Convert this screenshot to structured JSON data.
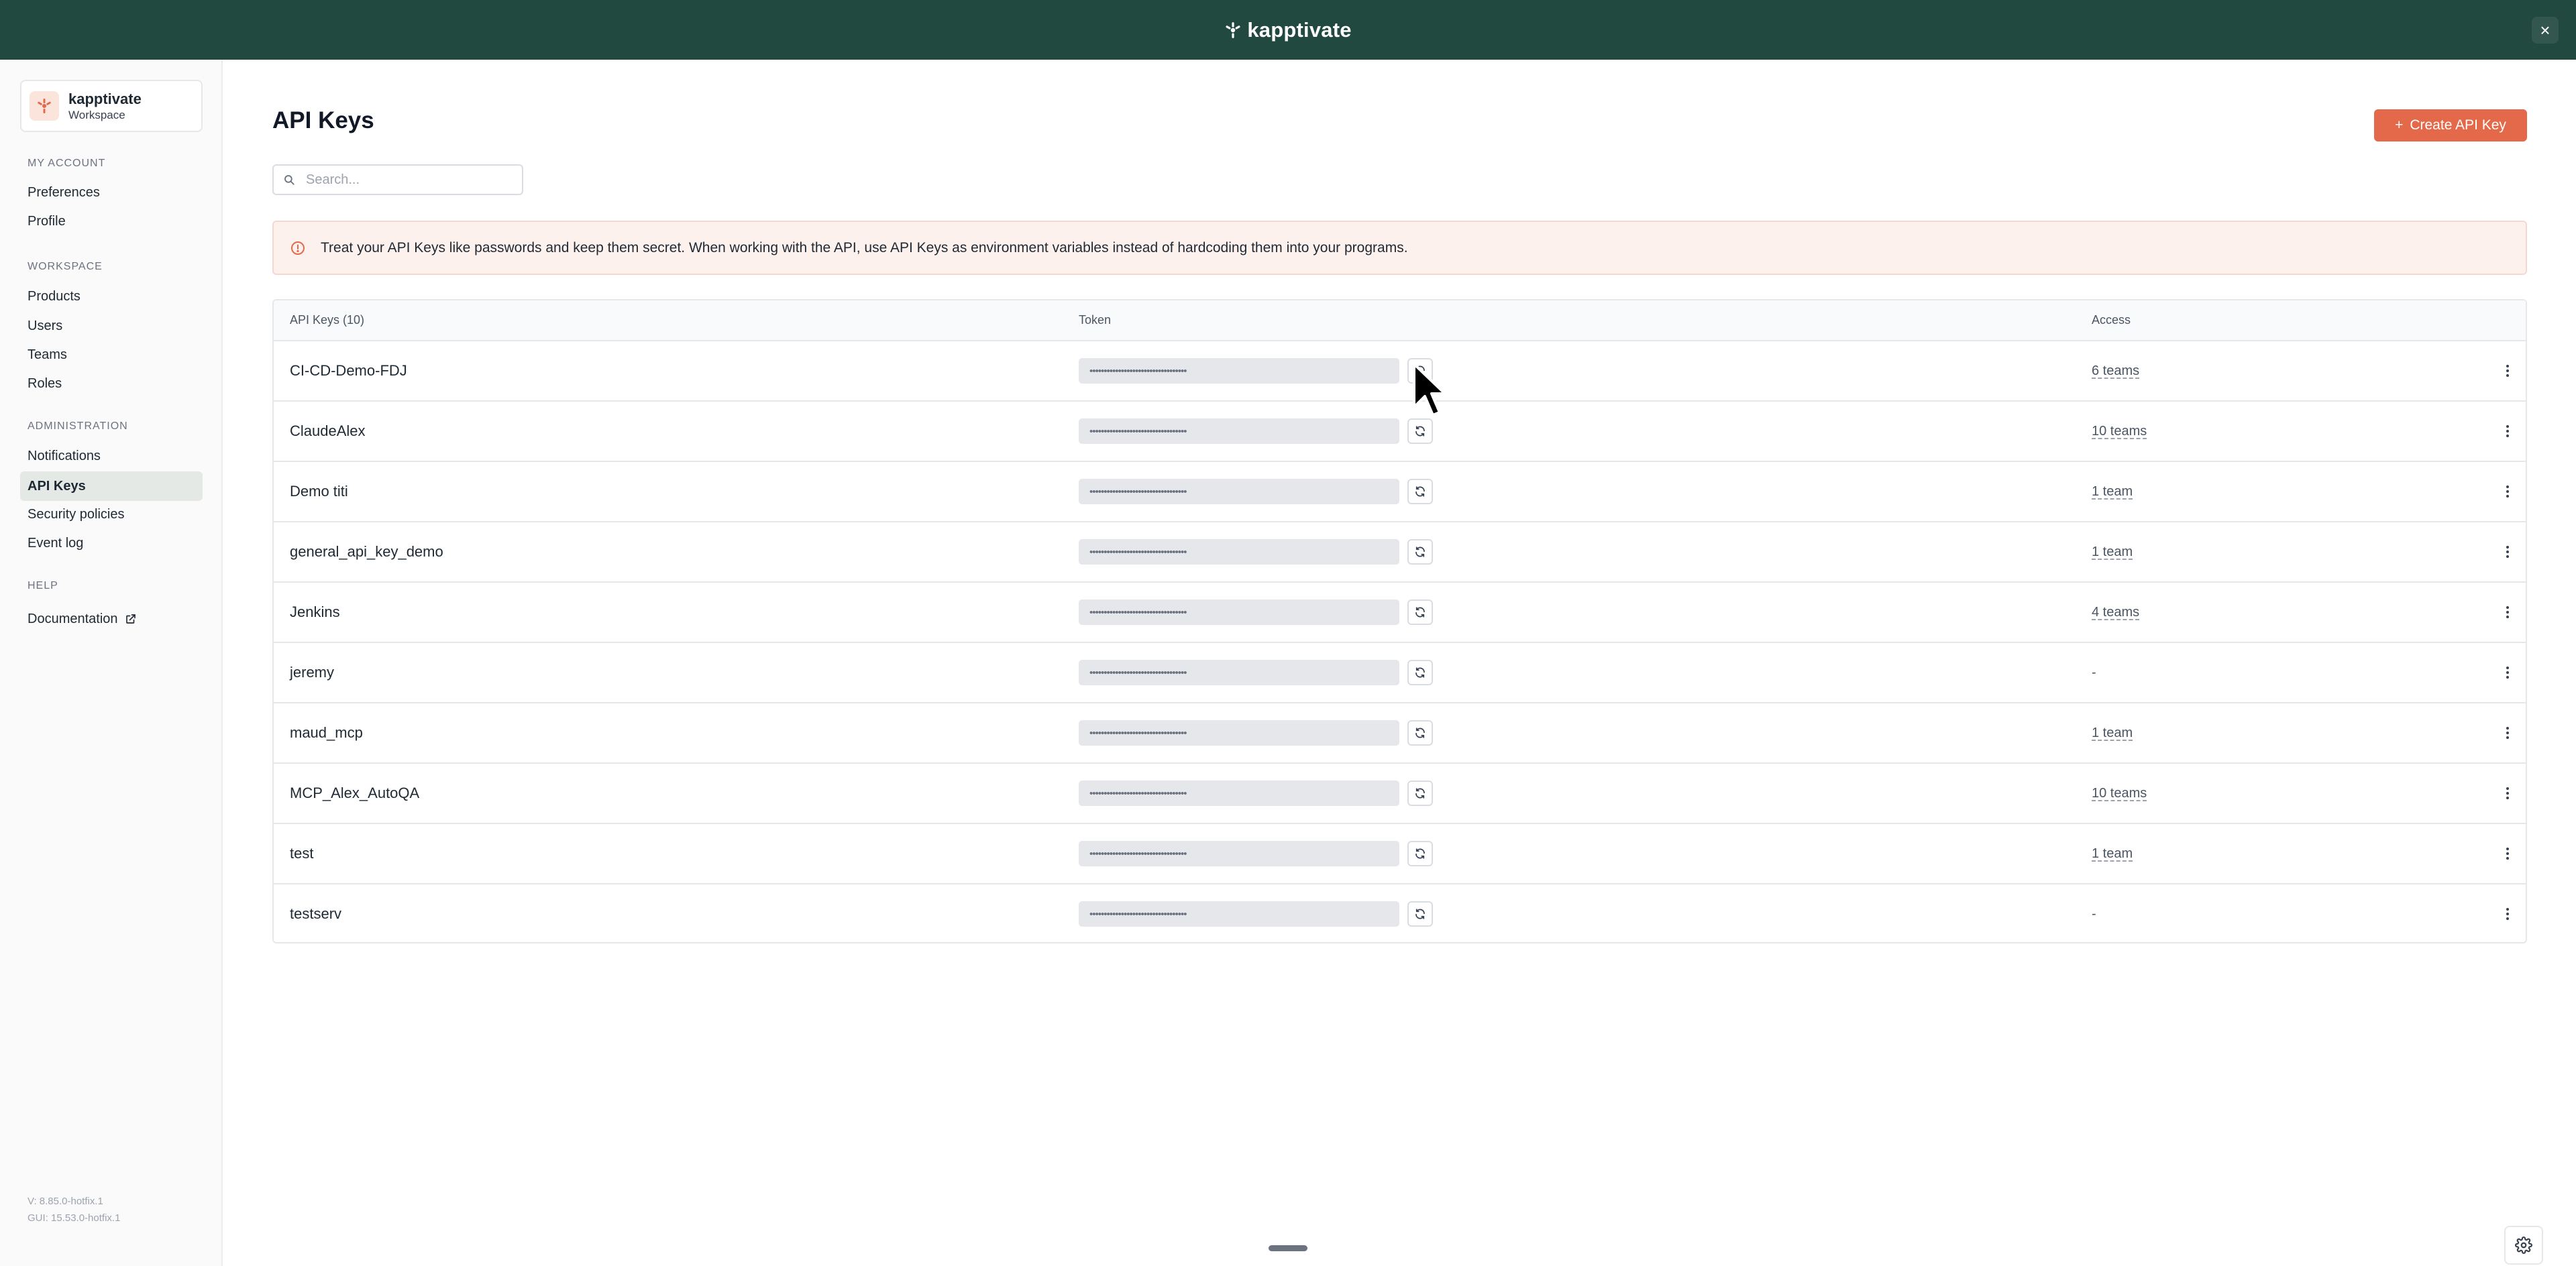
{
  "app": {
    "brand": "kapptivate"
  },
  "colors": {
    "topbar": "#22493f",
    "accent": "#e3694a",
    "alert_bg": "#fdf1ee"
  },
  "workspace": {
    "name": "kapptivate",
    "subtitle": "Workspace"
  },
  "sidebar": {
    "sections": [
      {
        "label": "MY ACCOUNT",
        "items": [
          {
            "label": "Preferences"
          },
          {
            "label": "Profile"
          }
        ]
      },
      {
        "label": "WORKSPACE",
        "items": [
          {
            "label": "Products"
          },
          {
            "label": "Users"
          },
          {
            "label": "Teams"
          },
          {
            "label": "Roles"
          }
        ]
      },
      {
        "label": "ADMINISTRATION",
        "items": [
          {
            "label": "Notifications"
          },
          {
            "label": "API Keys",
            "active": true
          },
          {
            "label": "Security policies"
          },
          {
            "label": "Event log"
          }
        ]
      },
      {
        "label": "HELP",
        "items": [
          {
            "label": "Documentation",
            "external_icon": "external-link-icon"
          }
        ]
      }
    ],
    "version": "V: 8.85.0-hotfix.1",
    "gui_version": "GUI: 15.53.0-hotfix.1"
  },
  "main": {
    "title": "API Keys",
    "create_button": {
      "icon": "plus-icon",
      "label": "Create API Key"
    },
    "search": {
      "placeholder": "Search...",
      "value": ""
    },
    "alert": {
      "icon": "info-icon",
      "text": "Treat your API Keys like passwords and keep them secret. When working with the API, use API Keys as environment variables instead of hardcoding them into your programs."
    },
    "table": {
      "headers": {
        "name": "API Keys (10)",
        "token": "Token",
        "access": "Access"
      },
      "rows": [
        {
          "name": "CI-CD-Demo-FDJ",
          "token": "••••••••••••••••••••••••••••••••••",
          "access": "6 teams"
        },
        {
          "name": "ClaudeAlex",
          "token": "••••••••••••••••••••••••••••••••••",
          "access": "10 teams"
        },
        {
          "name": "Demo titi",
          "token": "••••••••••••••••••••••••••••••••••",
          "access": "1 team"
        },
        {
          "name": "general_api_key_demo",
          "token": "••••••••••••••••••••••••••••••••••",
          "access": "1 team"
        },
        {
          "name": "Jenkins",
          "token": "••••••••••••••••••••••••••••••••••",
          "access": "4 teams"
        },
        {
          "name": "jeremy",
          "token": "••••••••••••••••••••••••••••••••••",
          "access": "-"
        },
        {
          "name": "maud_mcp",
          "token": "••••••••••••••••••••••••••••••••••",
          "access": "1 team"
        },
        {
          "name": "MCP_Alex_AutoQA",
          "token": "••••••••••••••••••••••••••••••••••",
          "access": "10 teams"
        },
        {
          "name": "test",
          "token": "••••••••••••••••••••••••••••••••••",
          "access": "1 team"
        },
        {
          "name": "testserv",
          "token": "••••••••••••••••••••••••••••••••••",
          "access": "-"
        }
      ]
    }
  },
  "icons": {
    "close": "×",
    "regenerate": "refresh-icon",
    "row_menu": "more-vertical-icon",
    "settings": "gear-icon"
  }
}
